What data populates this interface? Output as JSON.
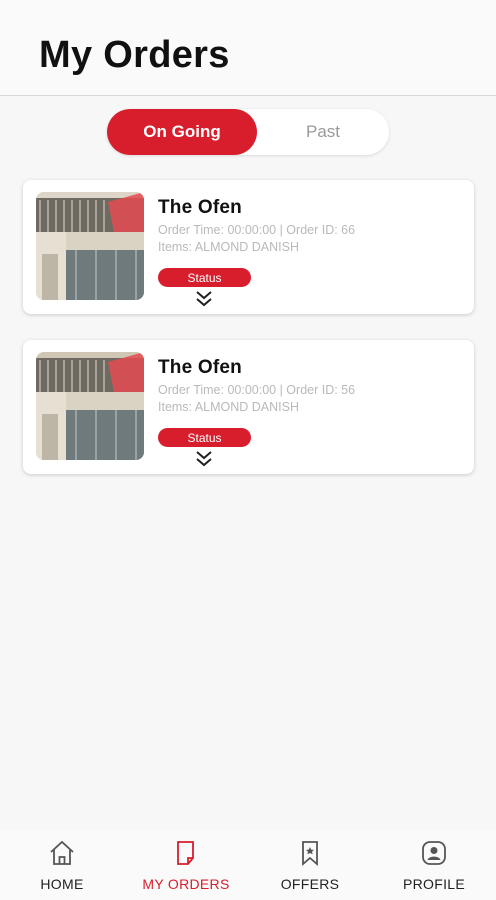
{
  "header": {
    "title": "My Orders"
  },
  "tabs": [
    {
      "label": "On Going",
      "active": true
    },
    {
      "label": "Past",
      "active": false
    }
  ],
  "orders": [
    {
      "restaurant": "The Ofen",
      "order_line": "Order Time: 00:00:00 | Order ID: 66",
      "items_line": "Items: ALMOND DANISH",
      "status_label": "Status",
      "expand_icon": "double-chevron-down-icon"
    },
    {
      "restaurant": "The Ofen",
      "order_line": "Order Time: 00:00:00 | Order ID: 56",
      "items_line": "Items: ALMOND DANISH",
      "status_label": "Status",
      "expand_icon": "double-chevron-down-icon"
    }
  ],
  "bottom_nav": [
    {
      "label": "HOME",
      "icon": "home-icon",
      "active": false
    },
    {
      "label": "MY ORDERS",
      "icon": "orders-icon",
      "active": true
    },
    {
      "label": "OFFERS",
      "icon": "bookmark-icon",
      "active": false
    },
    {
      "label": "PROFILE",
      "icon": "profile-icon",
      "active": false
    }
  ],
  "colors": {
    "accent": "#d81e2c",
    "muted_text": "#b9b9b9"
  }
}
